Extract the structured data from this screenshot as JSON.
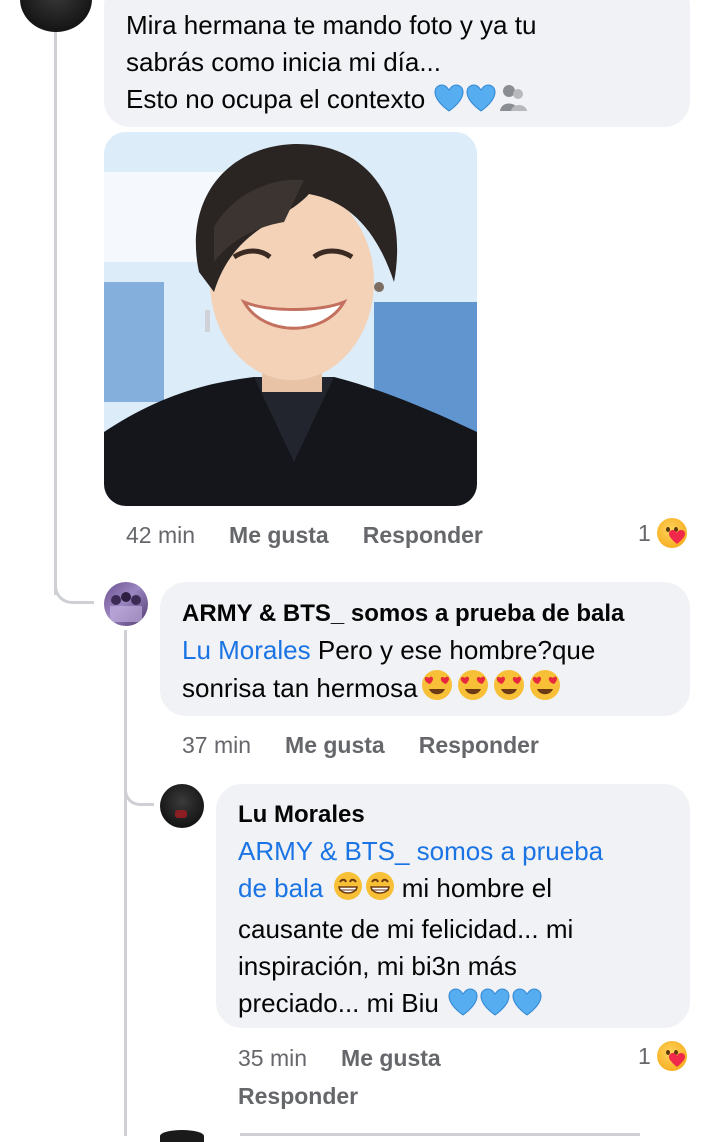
{
  "top_comment": {
    "text_lines": [
      "Mira hermana te mando foto y ya tu",
      "sabrás como inicia mi día...",
      "Esto no ocupa el contexto"
    ],
    "time": "42 min",
    "like_label": "Me gusta",
    "reply_label": "Responder",
    "reaction_count": "1"
  },
  "reply1": {
    "author": "ARMY & BTS_ somos a prueba de bala",
    "mention": "Lu Morales",
    "text_line1": " Pero y ese hombre?que",
    "text_line2": "sonrisa tan hermosa",
    "time": "37 min",
    "like_label": "Me gusta",
    "reply_label": "Responder"
  },
  "reply2": {
    "author": "Lu Morales",
    "mention_line1": "ARMY & BTS_ somos a prueba",
    "mention_line2": "de bala",
    "text_after_mention": " mi hombre  el",
    "text_line3": "causante de mi felicidad... mi",
    "text_line4": "inspiración, mi bi3n más",
    "text_line5": "preciado... mi Biu",
    "time": "35 min",
    "like_label": "Me gusta",
    "reply_label": "Responder",
    "reaction_count": "1"
  },
  "colors": {
    "bubble": "#f0f2f5",
    "mention": "#1b74e4",
    "meta": "#65676b",
    "thread_line": "#ced0d4"
  },
  "icons": [
    "blue-heart-icon",
    "hugging-person-icon",
    "heart-eyes-emoji-icon",
    "grinning-emoji-icon",
    "care-reaction-icon"
  ]
}
